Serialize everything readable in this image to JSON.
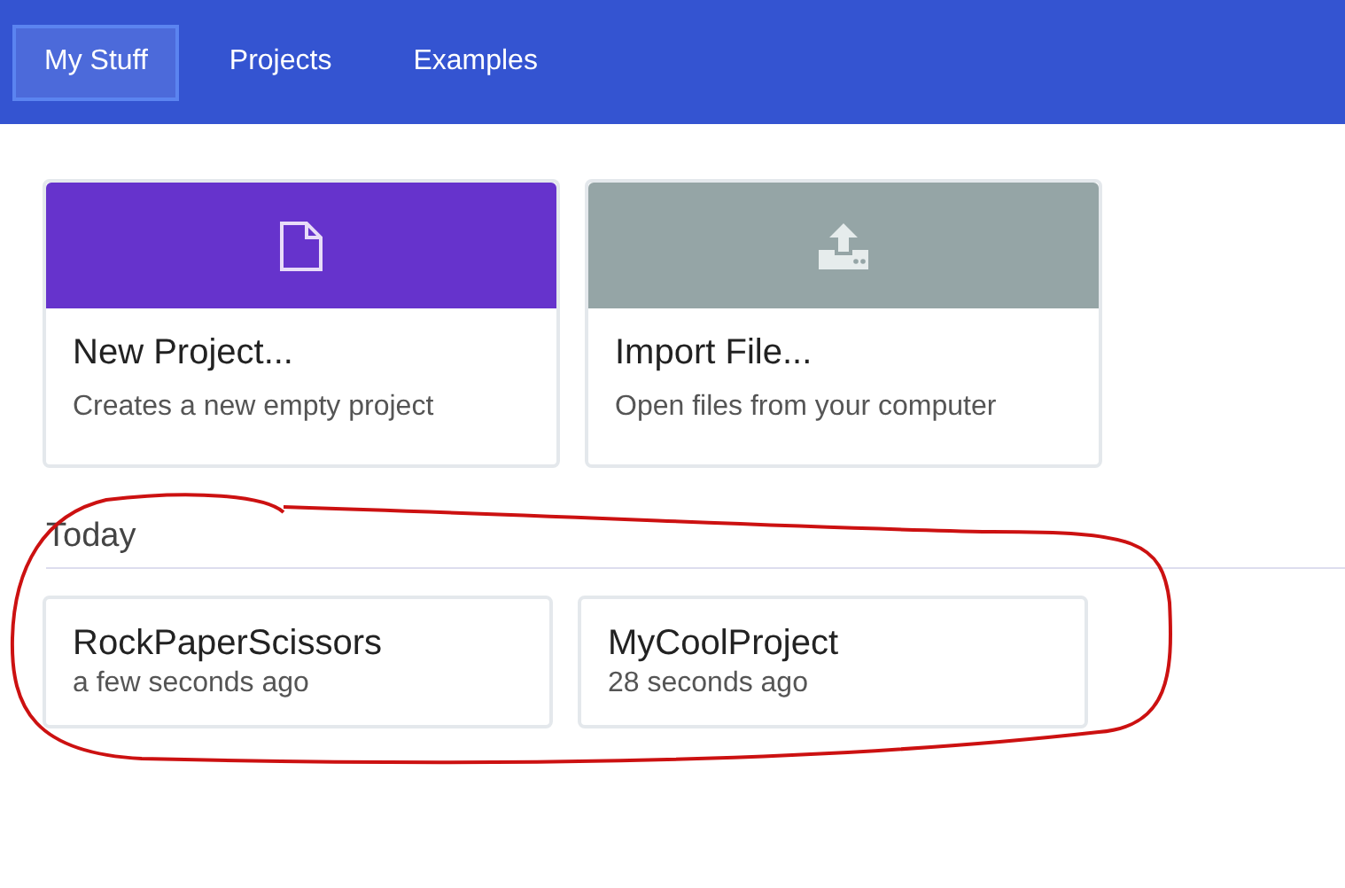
{
  "tabs": [
    {
      "label": "My Stuff",
      "selected": true
    },
    {
      "label": "Projects",
      "selected": false
    },
    {
      "label": "Examples",
      "selected": false
    }
  ],
  "actions": [
    {
      "kind": "new",
      "color": "#6633cc",
      "title": "New Project...",
      "description": "Creates a new empty project"
    },
    {
      "kind": "import",
      "color": "#95a5a6",
      "title": "Import File...",
      "description": "Open files from your computer"
    }
  ],
  "sections": [
    {
      "heading": "Today",
      "projects": [
        {
          "name": "RockPaperScissors",
          "time": "a few seconds ago"
        },
        {
          "name": "MyCoolProject",
          "time": "28 seconds ago"
        }
      ]
    }
  ]
}
